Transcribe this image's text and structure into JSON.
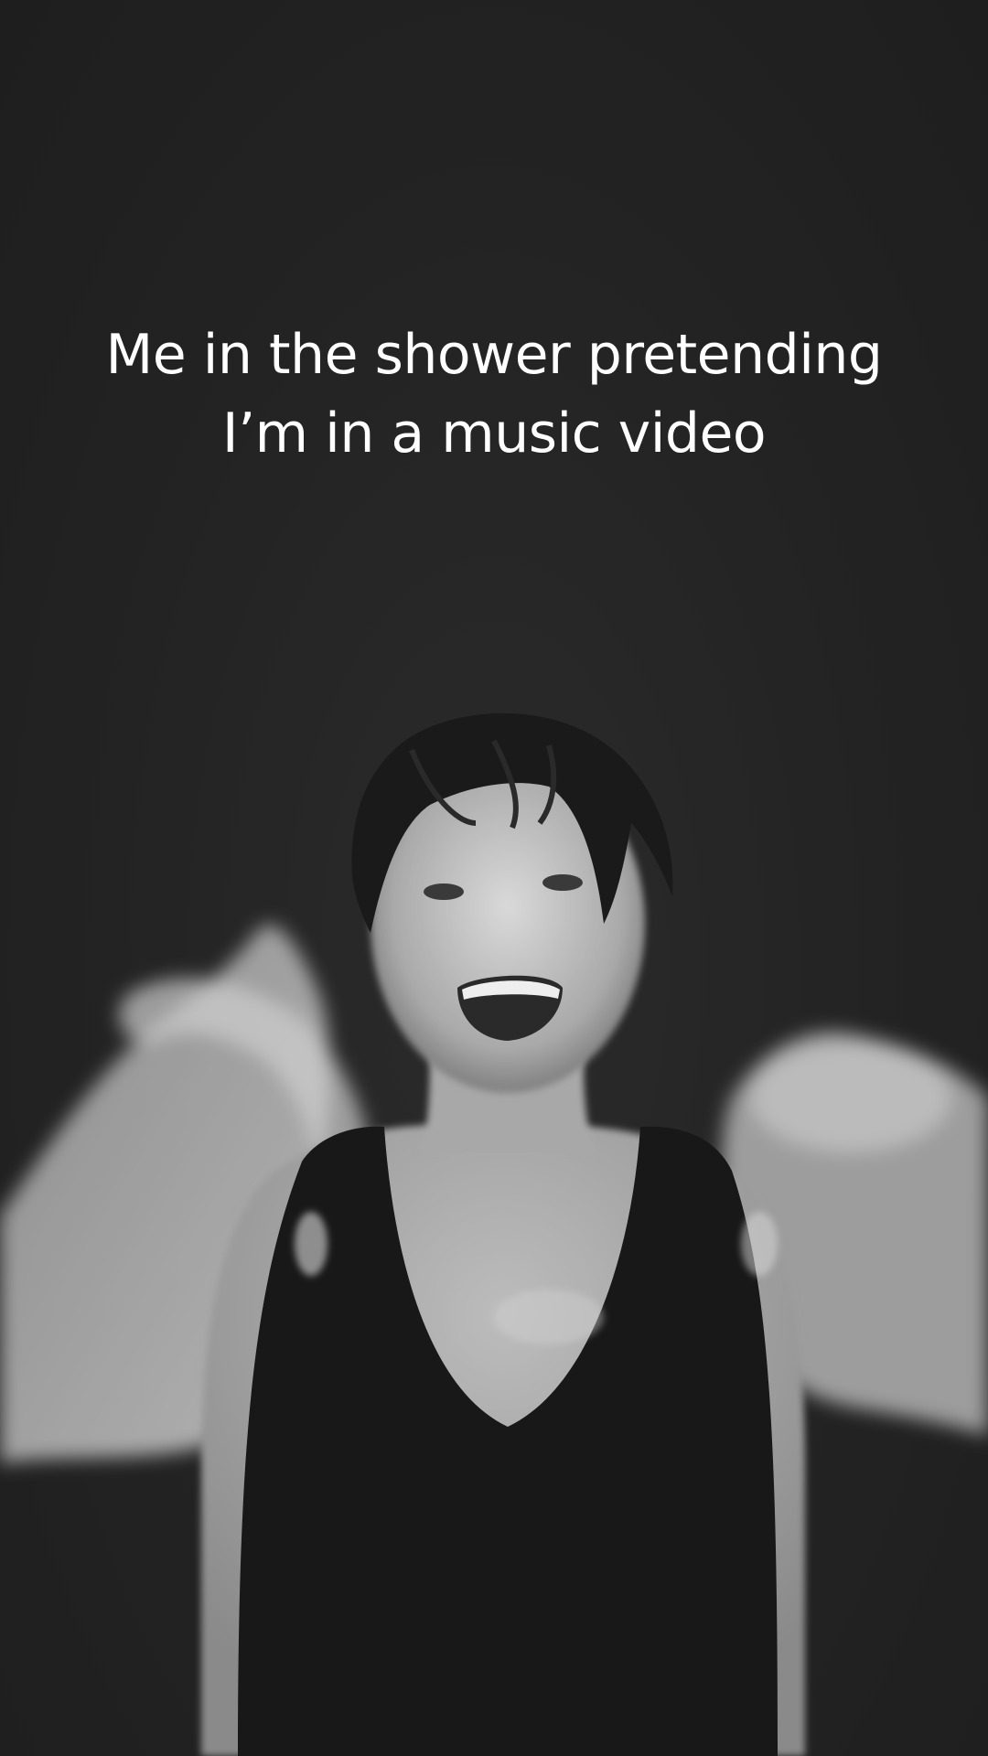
{
  "caption": {
    "line1": "Me in the shower pretending",
    "line2": "I’m in a music video"
  },
  "colors": {
    "background": "#262626",
    "text": "#ffffff"
  }
}
